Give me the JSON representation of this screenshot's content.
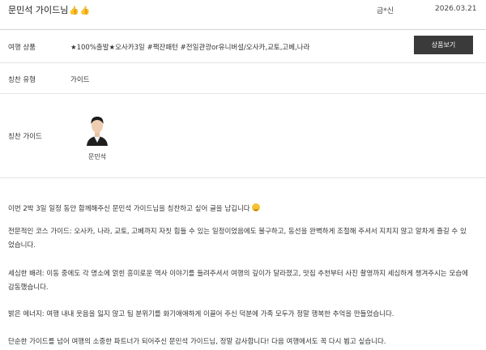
{
  "header": {
    "title": "문민석 가이드님",
    "author": "금*신",
    "date": "2026.03.21"
  },
  "info": {
    "product_label": "여행 상품",
    "product_value": "★100%출발★오사카3일 #팩잔패턴 #전일관광or유니버설/오사카,교토,고베,나라",
    "product_button": "상품보기",
    "praise_type_label": "칭찬 유형",
    "praise_type_value": "가이드",
    "praise_guide_label": "칭찬 가이드",
    "guide_name": "문민석"
  },
  "body": {
    "p1": "이번 2박 3일 일정 동안 함께해주신 문민석 가이드님을 칭찬하고 싶어 글을 남깁니다",
    "p2": "전문적인 코스 가이드: 오사카, 나라, 교토, 고베까지 자칫 힘들 수 있는 일정이었음에도 불구하고, 동선을 완벽하게 조절해 주셔서 지치지 않고 알차게 즐길 수 있었습니다.",
    "p3": "세심한 배려: 이동 중에도 각 명소에 얽힌 흥미로운 역사 이야기를 들려주셔서 여행의 깊이가 달라졌고, 맛집 추천부터 사진 촬영까지 세심하게 챙겨주시는 모습에 감동했습니다.",
    "p4": "밝은 에너지: 여행 내내 웃음을 잃지 않고 팀 분위기를 화기애애하게 이끌어 주신 덕분에 가족 모두가 정말 행복한 추억을 만들었습니다.",
    "p5": "단순한 가이드를 넘어 여행의 소중한 파트너가 되어주신 문민석 가이드님, 정말 감사합니다! 다음 여행에서도 꼭 다시 뵙고 싶습니다."
  },
  "icons": {
    "title_emoji": "thumbs-up-icon",
    "smile_emoji": "smile-icon"
  }
}
